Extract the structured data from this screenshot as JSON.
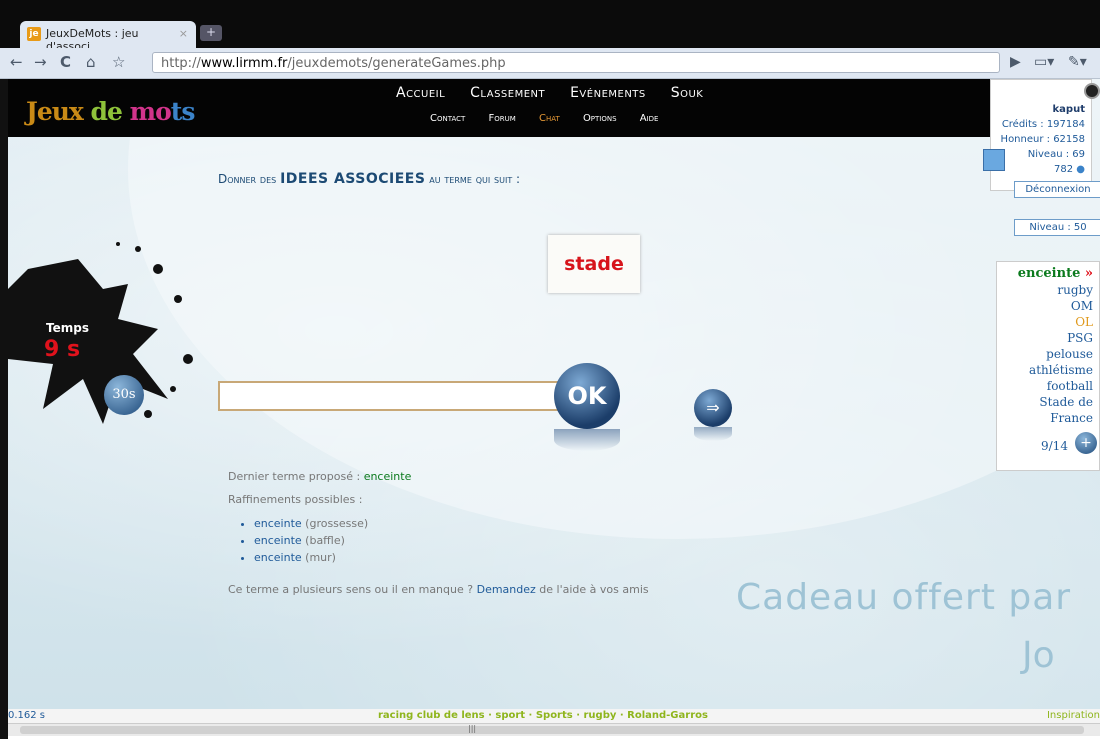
{
  "browser": {
    "tab_title": "JeuxDeMots : jeu d'associ...",
    "tab_close": "×",
    "favicon_text": "je",
    "new_tab": "+",
    "url_prefix": "http://",
    "url_host": "www.lirmm.fr",
    "url_path": "/jeuxdemots/generateGames.php"
  },
  "header": {
    "logo": {
      "part1": "Jeux",
      "part2": " de ",
      "part3": "mo",
      "part4": "ts"
    },
    "nav_main": [
      "Accueil",
      "Classement",
      "Evénements",
      "Souk"
    ],
    "nav_sub": [
      "Contact",
      "Forum",
      "Chat",
      "Options",
      "Aide"
    ]
  },
  "user": {
    "name": "kaput",
    "credits": "Crédits : 197184",
    "honneur": "Honneur : 62158",
    "niveau": "Niveau : 69",
    "coins": "782",
    "logout": "Déconnexion",
    "level_box": "Niveau : 50"
  },
  "game": {
    "prompt_prefix": "Donner des",
    "prompt_bold": "IDEES ASSOCIEES",
    "prompt_suffix": "au terme qui suit :",
    "term": "stade",
    "time_label": "Temps",
    "time_value": "9 s",
    "bonus": "30s",
    "ok_label": "OK",
    "next_label": "⇒",
    "last_term_label": "Dernier terme proposé : ",
    "last_term": "enceinte",
    "refinements_label": "Raffinements possibles :",
    "refinements": [
      {
        "term": "enceinte",
        "gloss": " (grossesse)"
      },
      {
        "term": "enceinte",
        "gloss": " (baffle)"
      },
      {
        "term": "enceinte",
        "gloss": " (mur)"
      }
    ],
    "help_prefix": "Ce terme a plusieurs sens ou il en manque ? ",
    "help_link": "Demandez",
    "help_suffix": " de l'aide à vos amis"
  },
  "associations": {
    "head": "enceinte",
    "head_arrow": "»",
    "items": [
      "rugby",
      "OM",
      "OL",
      "PSG",
      "pelouse",
      "athlétisme",
      "football",
      "Stade de France"
    ],
    "count": "9/14",
    "plus": "+"
  },
  "gift": {
    "text": "Cadeau offert par",
    "name": "Jo"
  },
  "status": {
    "time": "0.162 s",
    "links": "racing club de lens · sport · Sports · rugby · Roland-Garros",
    "inspiration": "Inspiration"
  }
}
